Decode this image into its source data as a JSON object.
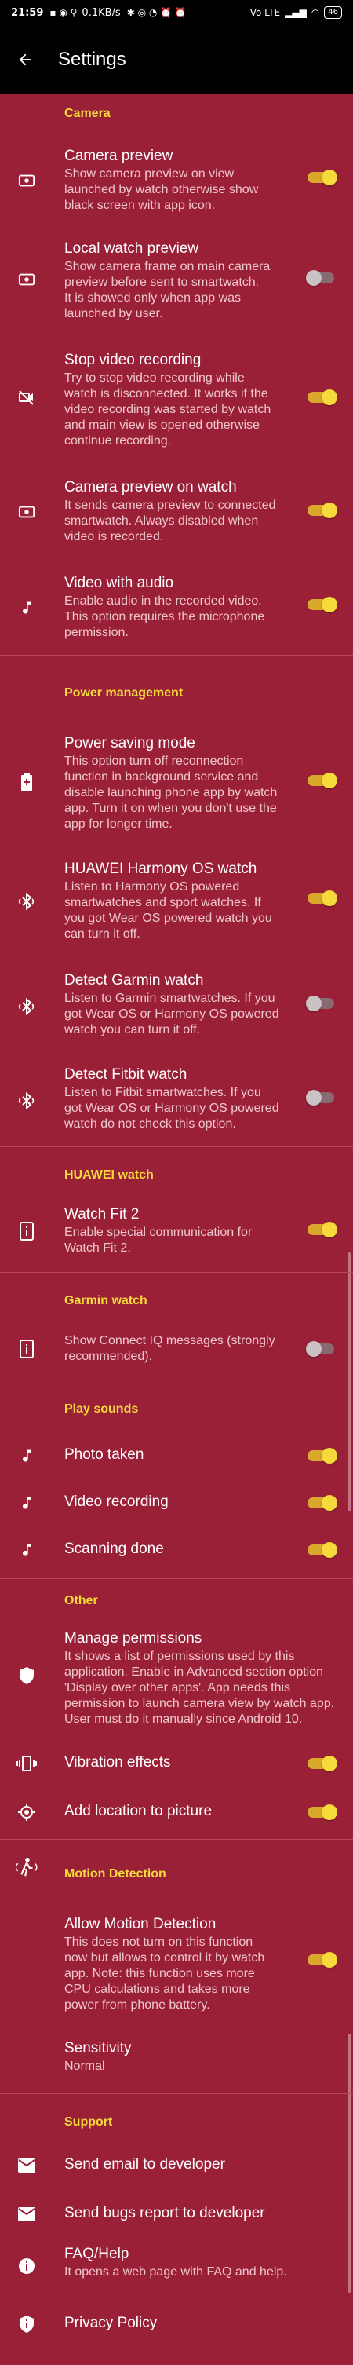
{
  "status": {
    "time": "21:59",
    "speed": "0.1KB/s",
    "signal": "Vo LTE",
    "battery": "46"
  },
  "appbar": {
    "title": "Settings"
  },
  "categories": {
    "camera": "Camera",
    "power": "Power management",
    "huawei": "HUAWEI watch",
    "garmin": "Garmin watch",
    "sounds": "Play sounds",
    "other": "Other",
    "motion": "Motion Detection",
    "support": "Support"
  },
  "settings": {
    "camera_preview": {
      "title": "Camera preview",
      "summary": [
        "Show camera preview on view",
        "launched by watch otherwise show",
        "black screen with app icon."
      ],
      "toggle": "on"
    },
    "local_preview": {
      "title": "Local watch preview",
      "summary": [
        "Show camera frame on main camera",
        "preview before sent to smartwatch.",
        "It is showed only when app was",
        "launched by user."
      ],
      "toggle": "off"
    },
    "stop_video": {
      "title": "Stop video recording",
      "summary": [
        "Try to stop video recording while",
        "watch is disconnected. It works if the",
        "video recording was started by watch",
        "and main view is opened otherwise",
        "continue recording."
      ],
      "toggle": "on"
    },
    "preview_on_watch": {
      "title": "Camera preview on watch",
      "summary": [
        "It sends camera preview to connected",
        "smartwatch. Always disabled when",
        "video is recorded."
      ],
      "toggle": "on"
    },
    "video_audio": {
      "title": "Video with audio",
      "summary": [
        "Enable audio in the recorded video.",
        "This option requires the microphone",
        "permission."
      ],
      "toggle": "on"
    },
    "power_saving": {
      "title": "Power saving mode",
      "summary": [
        "This option turn off reconnection",
        "function in background service and",
        "disable launching phone app by watch",
        "app. Turn it on when you don't use the",
        "app for longer time."
      ],
      "toggle": "on"
    },
    "harmony": {
      "title": "HUAWEI Harmony OS watch",
      "summary": [
        "Listen to Harmony OS powered",
        "smartwatches and sport watches. If",
        "you got Wear OS powered watch you",
        "can turn it off."
      ],
      "toggle": "on"
    },
    "garmin_detect": {
      "title": "Detect Garmin watch",
      "summary": [
        "Listen to Garmin smartwatches. If you",
        "got Wear OS or Harmony OS powered",
        "watch you can turn it off."
      ],
      "toggle": "off"
    },
    "fitbit_detect": {
      "title": "Detect Fitbit watch",
      "summary": [
        "Listen to Fitbit smartwatches. If you",
        "got Wear OS or Harmony OS powered",
        "watch do not check this option."
      ],
      "toggle": "off"
    },
    "watch_fit": {
      "title": "Watch Fit 2",
      "summary": [
        "Enable special communication for",
        "Watch Fit 2."
      ],
      "toggle": "on"
    },
    "connect_iq": {
      "summary": [
        "Show Connect IQ messages (strongly",
        "recommended)."
      ],
      "toggle": "off"
    },
    "photo_taken": {
      "title": "Photo taken",
      "toggle": "on"
    },
    "video_recording": {
      "title": "Video recording",
      "toggle": "on"
    },
    "scanning_done": {
      "title": "Scanning done",
      "toggle": "on"
    },
    "manage_permissions": {
      "title": "Manage permissions",
      "summary": [
        "It shows a list of permissions used by this",
        "application. Enable in Advanced section option",
        "'Display over other apps'. App needs this",
        "permission to launch camera view by watch app.",
        "User must do it manually since Android 10."
      ]
    },
    "vibration": {
      "title": "Vibration effects",
      "toggle": "on"
    },
    "location": {
      "title": "Add location to picture",
      "toggle": "on"
    },
    "motion_allow": {
      "title": "Allow Motion Detection",
      "summary": [
        "This does not turn on this function",
        "now but allows to control it by watch",
        "app. Note: this function uses more",
        "CPU calculations and takes more",
        "power from phone battery."
      ],
      "toggle": "on"
    },
    "sensitivity": {
      "title": "Sensitivity",
      "summary": [
        "Normal"
      ]
    },
    "email_dev": {
      "title": "Send email to developer"
    },
    "bugs_report": {
      "title": "Send bugs report to developer"
    },
    "faq": {
      "title": "FAQ/Help",
      "summary": [
        "It opens a web page with FAQ and help."
      ]
    },
    "privacy": {
      "title": "Privacy Policy"
    }
  },
  "colors": {
    "background": "#9a2038",
    "accent": "#f6d93a",
    "toggle_on": "#f6d93a",
    "toggle_off": "#c9c3c5"
  }
}
